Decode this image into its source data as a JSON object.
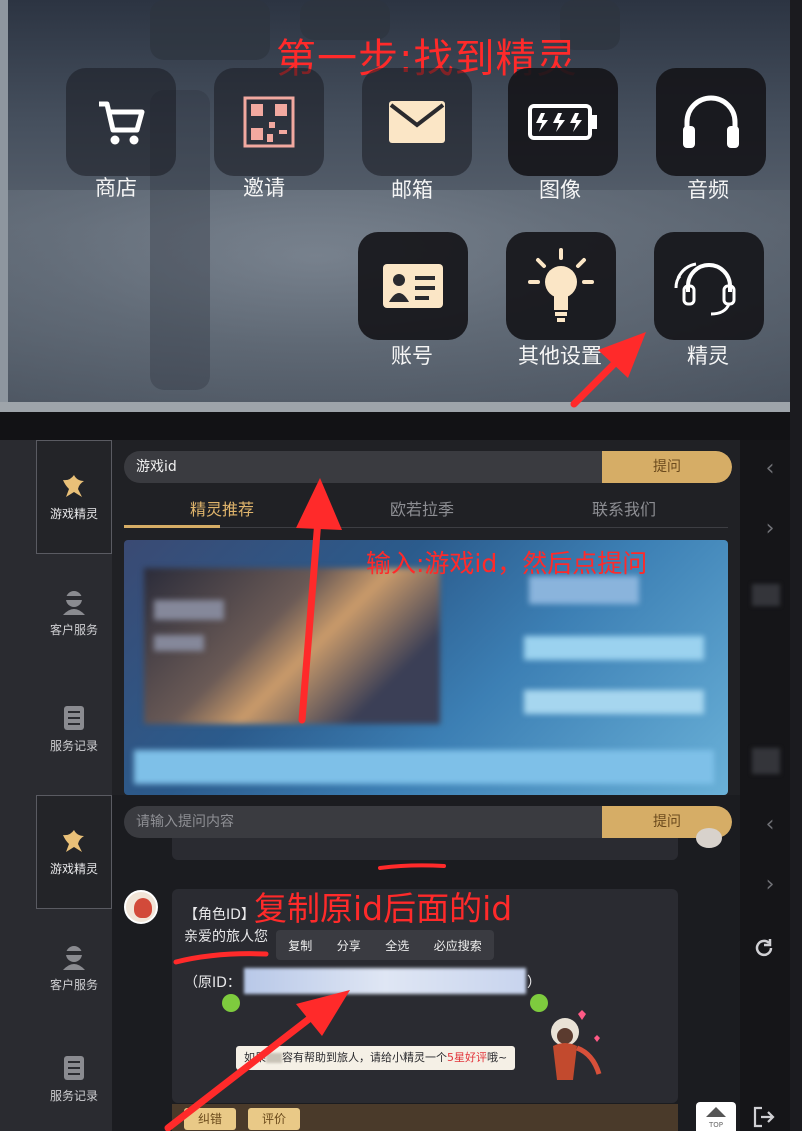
{
  "panel1": {
    "annotation": "第一步:找到精灵",
    "menu_items": [
      {
        "label": "商店",
        "icon": "cart-icon"
      },
      {
        "label": "邀请",
        "icon": "qr-code-icon"
      },
      {
        "label": "邮箱",
        "icon": "mail-icon"
      },
      {
        "label": "图像",
        "icon": "battery-icon"
      },
      {
        "label": "音频",
        "icon": "headphones-icon"
      },
      {
        "label": "账号",
        "icon": "id-card-icon"
      },
      {
        "label": "其他设置",
        "icon": "lightbulb-icon"
      },
      {
        "label": "精灵",
        "icon": "headset-icon"
      }
    ]
  },
  "sidebar": {
    "items": [
      {
        "label": "游戏精灵",
        "icon": "sprite-icon"
      },
      {
        "label": "客户服务",
        "icon": "support-agent-icon"
      },
      {
        "label": "服务记录",
        "icon": "records-icon"
      }
    ]
  },
  "panel2": {
    "search_value": "游戏id",
    "ask_label": "提问",
    "tabs": [
      "精灵推荐",
      "欧若拉季",
      "联系我们"
    ],
    "annotation": "输入:游戏id，然后点提问"
  },
  "panel3": {
    "search_placeholder": "请输入提问内容",
    "ask_label": "提问",
    "annotation": "复制原id后面的id",
    "message_tag": "【角色ID】",
    "message_greeting": "亲爱的旅人您",
    "context_menu": [
      "复制",
      "分享",
      "全选",
      "必应搜索"
    ],
    "original_id_prefix": "（原ID：",
    "original_id_suffix": "）",
    "feedback_prefix": "如果",
    "feedback_middle": "容有帮助到旅人，请给小精灵一个",
    "feedback_rating": "5星好评",
    "feedback_suffix": "哦~",
    "buttons": [
      "纠错",
      "评价"
    ],
    "top_label": "TOP"
  },
  "colors": {
    "annotation_red": "#ff2a2a",
    "gold": "#d6ad66",
    "panel_dark": "#202125"
  }
}
